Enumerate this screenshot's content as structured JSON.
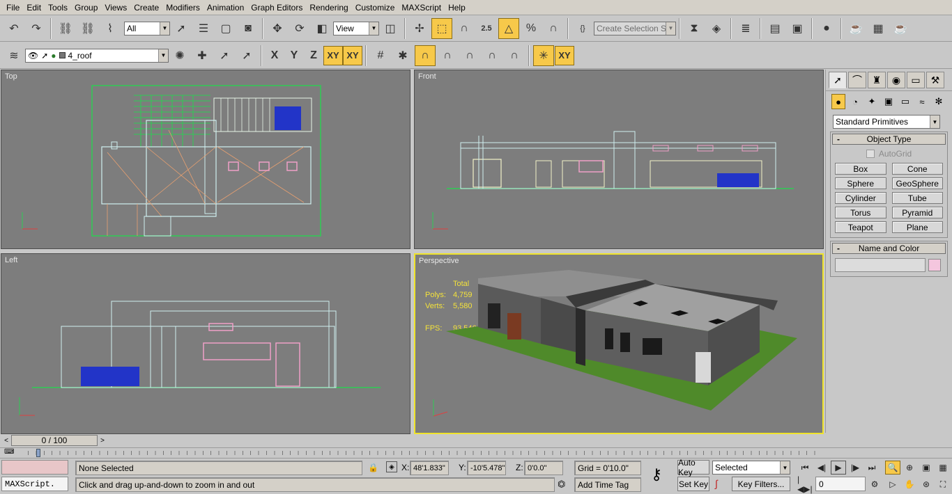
{
  "menu": [
    "File",
    "Edit",
    "Tools",
    "Group",
    "Views",
    "Create",
    "Modifiers",
    "Animation",
    "Graph Editors",
    "Rendering",
    "Customize",
    "MAXScript",
    "Help"
  ],
  "toolbar1": {
    "filter_value": "All",
    "refcoord_value": "View",
    "selection_set_placeholder": "Create Selection Set",
    "snap_value": "2.5"
  },
  "toolbar2": {
    "layer_value": "4_roof",
    "axis_x": "X",
    "axis_y": "Y",
    "axis_z": "Z",
    "axis_xy": "XY",
    "axis_xy2": "XY",
    "axis_xy3": "XY"
  },
  "viewports": {
    "top": "Top",
    "front": "Front",
    "left": "Left",
    "perspective": "Perspective"
  },
  "stats": {
    "header": "Total",
    "polys_label": "Polys:",
    "polys_value": "4,759",
    "verts_label": "Verts:",
    "verts_value": "5,580",
    "fps_label": "FPS:",
    "fps_value": "93.546"
  },
  "command_panel": {
    "category": "Standard Primitives",
    "object_type_title": "Object Type",
    "autogrid_label": "AutoGrid",
    "buttons": [
      "Box",
      "Cone",
      "Sphere",
      "GeoSphere",
      "Cylinder",
      "Tube",
      "Torus",
      "Pyramid",
      "Teapot",
      "Plane"
    ],
    "name_color_title": "Name and Color",
    "swatch_color": "#f4c6de"
  },
  "timeline": {
    "frame": "0 / 100"
  },
  "status": {
    "maxscript": "MAXScript.",
    "selection": "None Selected",
    "prompt": "Click and drag up-and-down to zoom in and out",
    "x_label": "X:",
    "x_value": "48'1.833\"",
    "y_label": "Y:",
    "y_value": "-10'5.478\"",
    "z_label": "Z:",
    "z_value": "0'0.0\"",
    "grid": "Grid = 0'10.0\"",
    "add_time_tag": "Add Time Tag",
    "auto_key": "Auto Key",
    "set_key": "Set Key",
    "selected": "Selected",
    "key_filters": "Key Filters...",
    "frame_value": "0"
  },
  "colors": {
    "accent": "#f7c94a",
    "viewport_bg": "#7d7d7d",
    "active_border": "#f0e42a"
  }
}
